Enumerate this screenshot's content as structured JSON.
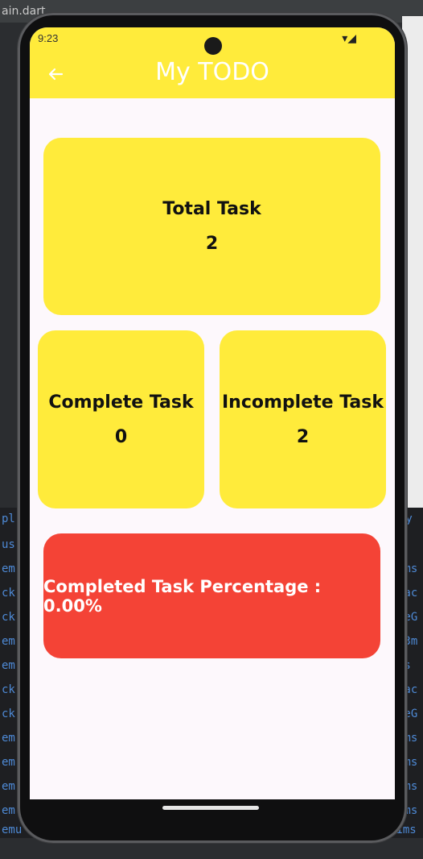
{
  "ide": {
    "tab_title": "ain.dart",
    "console_left": [
      "pl",
      "us",
      "em",
      "ck",
      "ck",
      "em",
      "em",
      "ck",
      "ck",
      "em",
      "em",
      "em",
      "em",
      "emu"
    ],
    "console_right": [
      "py",
      "0ms",
      "pac",
      "LeG",
      "93m",
      "ns",
      "pac",
      "LeG",
      "3ms",
      "6ms",
      "6ms",
      "8ms",
      "31ms"
    ]
  },
  "status_bar": {
    "time": "9:23",
    "icons": "▾◢"
  },
  "app_bar": {
    "title": "My TODO",
    "back_icon": "arrow-left-icon"
  },
  "cards": {
    "total": {
      "label": "Total Task",
      "value": "2"
    },
    "complete": {
      "label": "Complete Task",
      "value": "0"
    },
    "incomplete": {
      "label": "Incomplete Task",
      "value": "2"
    },
    "percentage": {
      "label": "Completed Task Percentage : 0.00%"
    }
  },
  "colors": {
    "app_bar": "#ffeb3b",
    "card": "#ffeb3b",
    "percentage_card": "#f44336",
    "screen_background": "#fdf8fc"
  }
}
